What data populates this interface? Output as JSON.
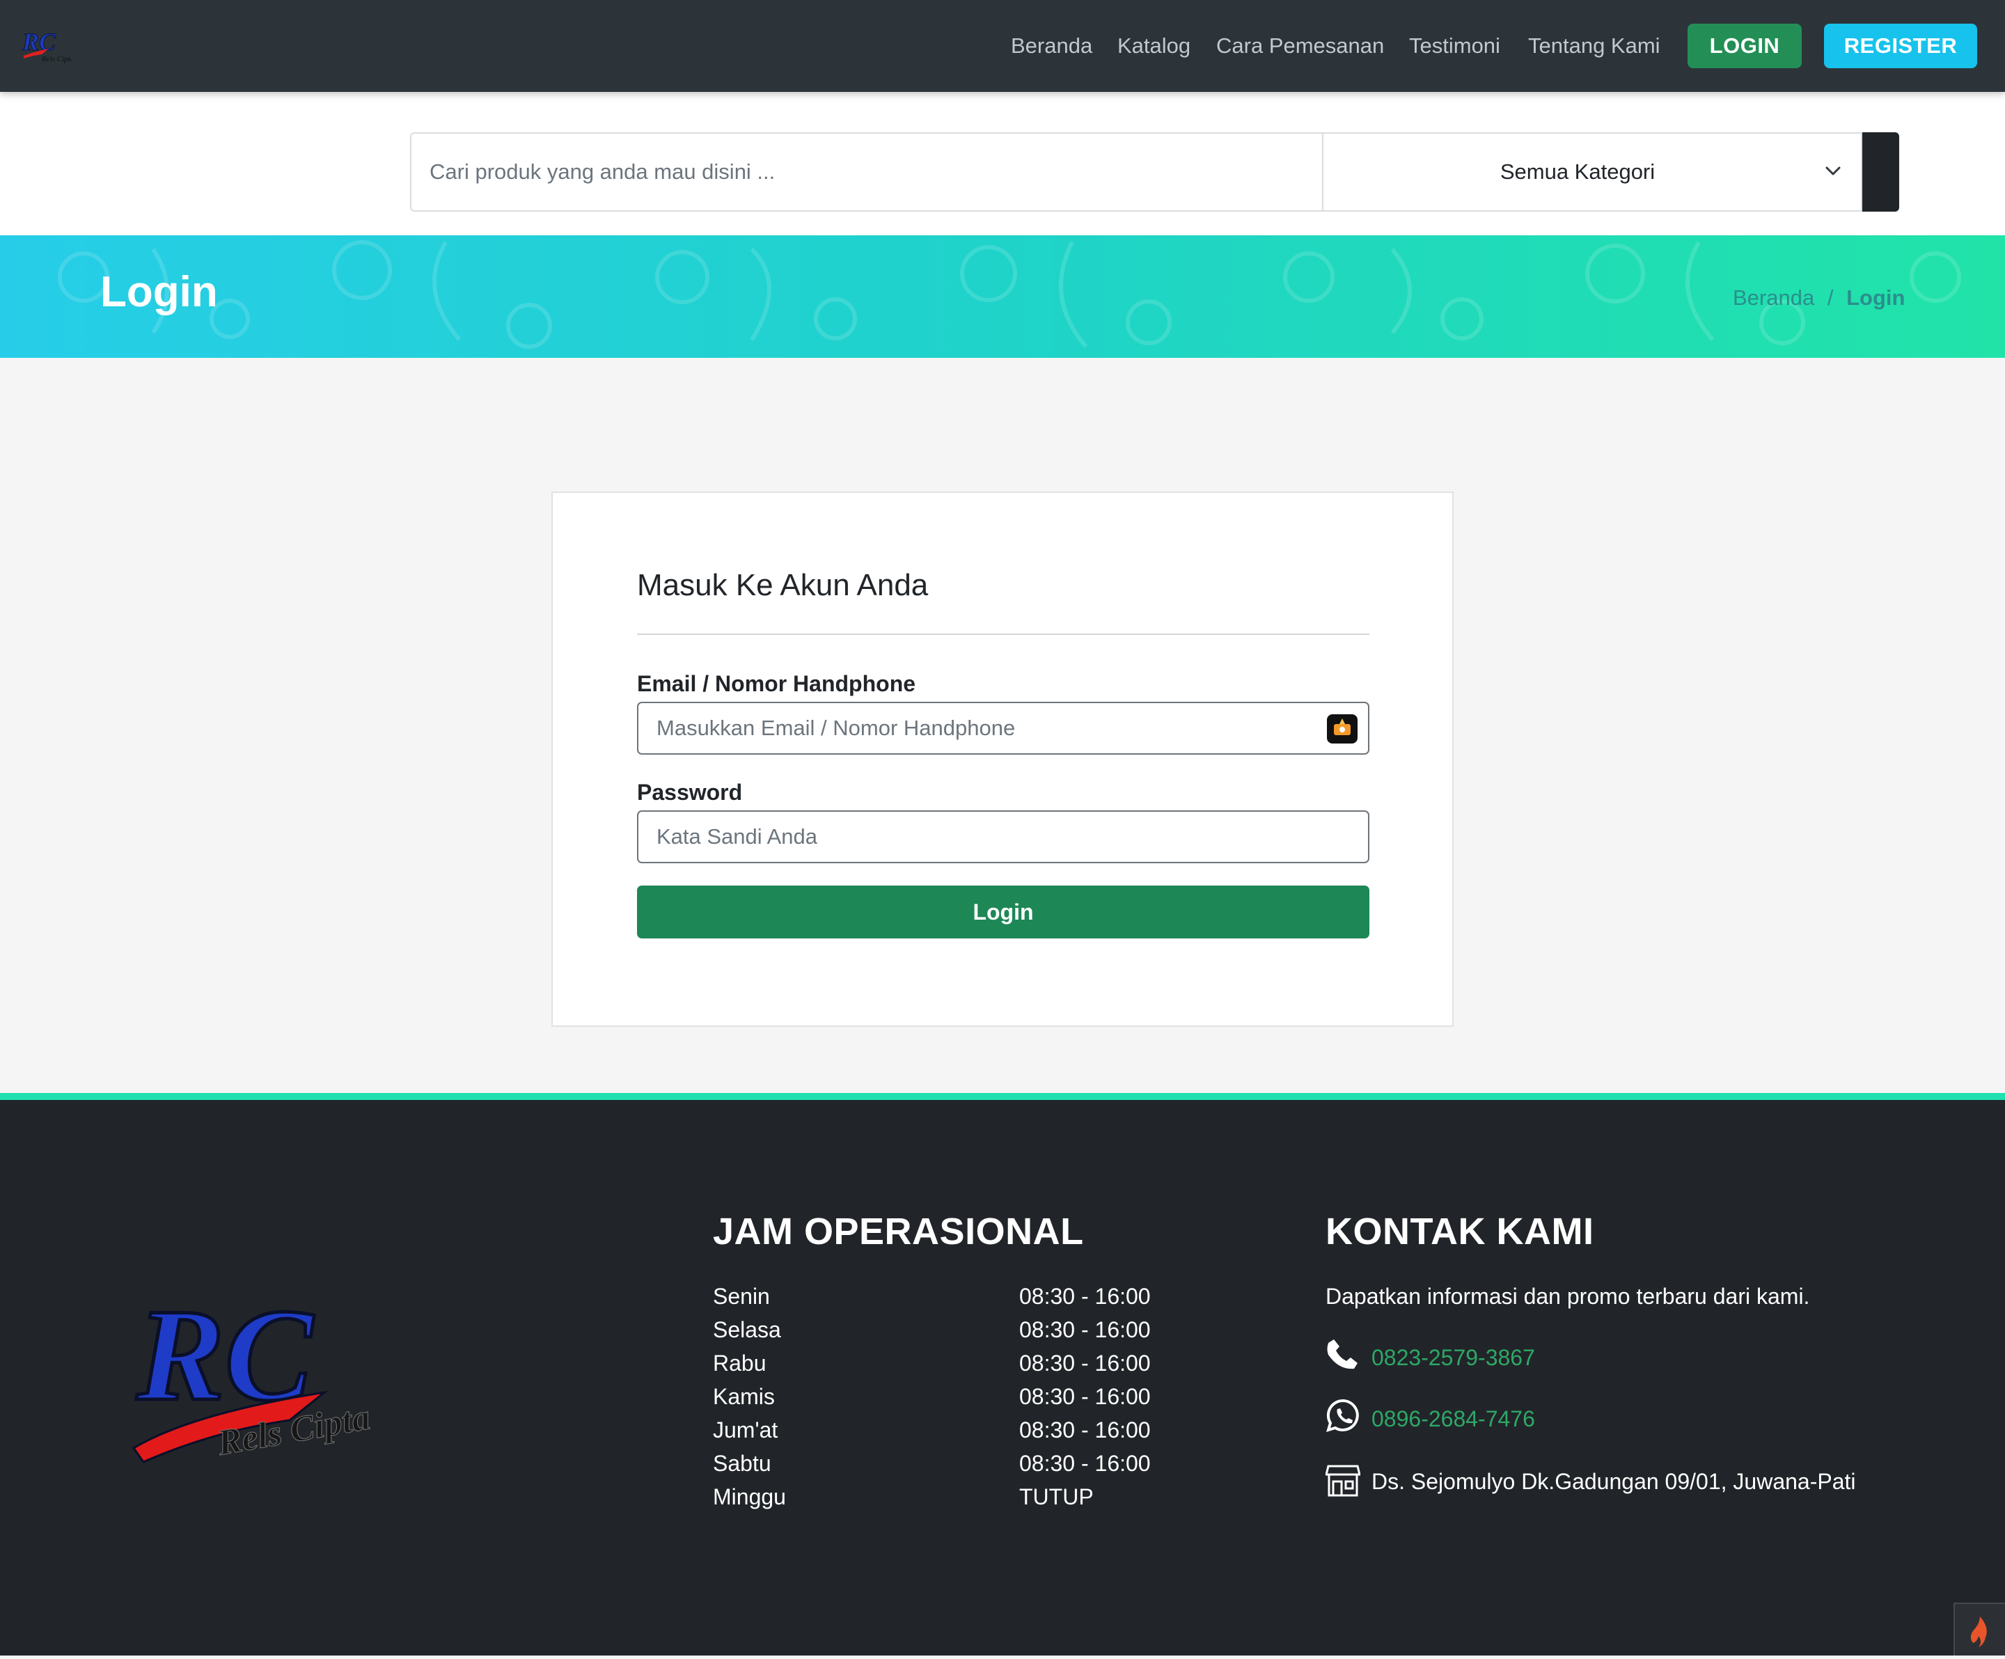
{
  "navbar": {
    "logo_icon": "rc-logo-icon",
    "links": [
      "Beranda",
      "Katalog",
      "Cara Pemesanan",
      "Testimoni",
      "Tentang Kami"
    ],
    "login_label": "LOGIN",
    "register_label": "REGISTER",
    "login_color": "#238f57",
    "register_color": "#17c2ec"
  },
  "search": {
    "placeholder": "Cari produk yang anda mau disini ...",
    "category": "Semua Kategori",
    "category_icon": "chevron-down-icon",
    "button_icon": "search-icon"
  },
  "banner": {
    "title": "Login",
    "breadcrumb": [
      "Beranda",
      "Login"
    ],
    "separator": "/"
  },
  "login": {
    "heading": "Masuk Ke Akun Anda",
    "email_label": "Email / Nomor Handphone",
    "email_placeholder": "Masukkan Email / Nomor Handphone",
    "email_icon": "autofill-key-icon",
    "password_label": "Password",
    "password_placeholder": "Kata Sandi Anda",
    "submit_label": "Login",
    "submit_color": "#1e8756"
  },
  "footer": {
    "logo_icon": "rc-logo-icon",
    "hours_title": "JAM OPERASIONAL",
    "hours": [
      {
        "day": "Senin",
        "time": "08:30 - 16:00"
      },
      {
        "day": "Selasa",
        "time": "08:30 - 16:00"
      },
      {
        "day": "Rabu",
        "time": "08:30 - 16:00"
      },
      {
        "day": "Kamis",
        "time": "08:30 - 16:00"
      },
      {
        "day": "Jum'at",
        "time": "08:30 - 16:00"
      },
      {
        "day": "Sabtu",
        "time": "08:30 - 16:00"
      },
      {
        "day": "Minggu",
        "time": "TUTUP"
      }
    ],
    "contact_title": "KONTAK KAMI",
    "contact_desc": "Dapatkan informasi dan promo terbaru dari kami.",
    "phone_icon": "phone-icon",
    "phone": "0823-2579-3867",
    "whatsapp_icon": "whatsapp-icon",
    "whatsapp": "0896-2684-7476",
    "address_icon": "store-icon",
    "address": "Ds. Sejomulyo Dk.Gadungan 09/01, Juwana-Pati",
    "link_color": "#2ea866"
  },
  "corner": {
    "icon": "flame-icon"
  }
}
